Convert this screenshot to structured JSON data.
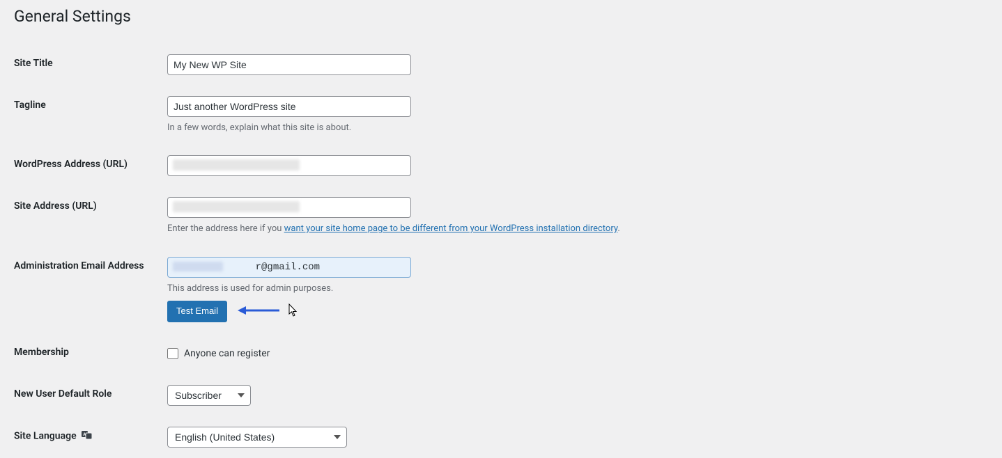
{
  "page": {
    "title": "General Settings"
  },
  "fields": {
    "site_title": {
      "label": "Site Title",
      "value": "My New WP Site"
    },
    "tagline": {
      "label": "Tagline",
      "value": "Just another WordPress site",
      "description": "In a few words, explain what this site is about."
    },
    "wp_address": {
      "label": "WordPress Address (URL)",
      "value": ""
    },
    "site_address": {
      "label": "Site Address (URL)",
      "value": "",
      "description_prefix": "Enter the address here if you ",
      "description_link": "want your site home page to be different from your WordPress installation directory",
      "description_suffix": "."
    },
    "admin_email": {
      "label": "Administration Email Address",
      "value": "              r@gmail.com",
      "description": "This address is used for admin purposes.",
      "button": "Test Email"
    },
    "membership": {
      "label": "Membership",
      "checkbox_label": "Anyone can register"
    },
    "default_role": {
      "label": "New User Default Role",
      "selected": "Subscriber"
    },
    "site_language": {
      "label": "Site Language",
      "selected": "English (United States)"
    }
  }
}
